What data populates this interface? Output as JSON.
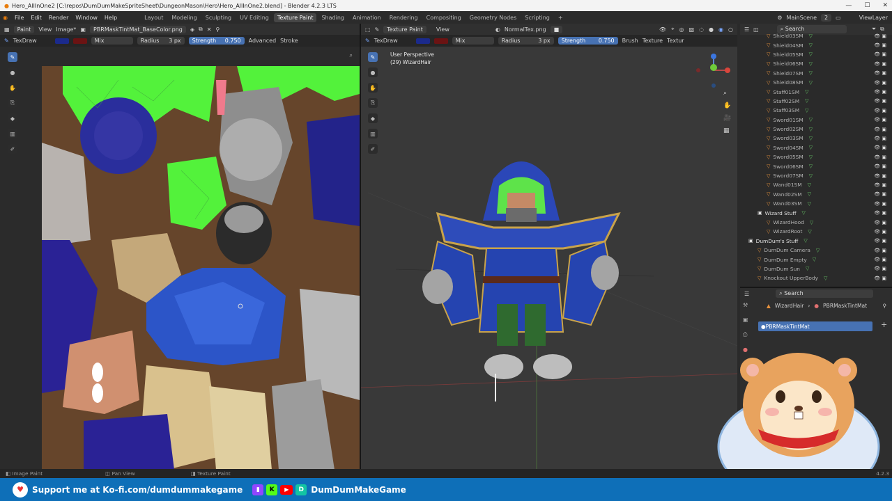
{
  "window": {
    "title": "Hero_AllInOne2 [C:\\repos\\DumDumMakeSpriteSheet\\DungeonMason\\Hero\\Hero_AllInOne2.blend] - Blender 4.2.3 LTS",
    "min": "—",
    "max": "☐",
    "close": "✕"
  },
  "menu": [
    "File",
    "Edit",
    "Render",
    "Window",
    "Help"
  ],
  "workspaces": [
    "Layout",
    "Modeling",
    "Sculpting",
    "UV Editing",
    "Texture Paint",
    "Shading",
    "Animation",
    "Rendering",
    "Compositing",
    "Geometry Nodes",
    "Scripting",
    "+"
  ],
  "scene": {
    "name": "MainScene",
    "counter": "2",
    "view_layer": "ViewLayer"
  },
  "image_editor": {
    "mode": "Paint",
    "view": "View",
    "image_menu": "Image*",
    "image_name": "PBRMaskTintMat_BaseColor.png",
    "tool_name": "TexDraw",
    "blend": "Mix",
    "radius_label": "Radius",
    "radius_value": "3 px",
    "strength_label": "Strength",
    "strength_value": "0.750",
    "advanced": "Advanced",
    "stroke": "Stroke"
  },
  "viewport": {
    "mode": "Texture Paint",
    "view": "View",
    "texture": "NormalTex.png",
    "tool_name": "TexDraw",
    "blend": "Mix",
    "radius_label": "Radius",
    "radius_value": "3 px",
    "strength_label": "Strength",
    "strength_value": "0.750",
    "brush": "Brush",
    "texture_menu": "Texture",
    "texture_more": "Textur",
    "perspective": "User Perspective",
    "object": "(29) WizardHair"
  },
  "outliner": {
    "search_placeholder": "Search",
    "items": [
      {
        "label": "Shield03SM",
        "indent": 2
      },
      {
        "label": "Shield04SM",
        "indent": 2
      },
      {
        "label": "Shield05SM",
        "indent": 2
      },
      {
        "label": "Shield06SM",
        "indent": 2
      },
      {
        "label": "Shield07SM",
        "indent": 2
      },
      {
        "label": "Shield08SM",
        "indent": 2
      },
      {
        "label": "Staff01SM",
        "indent": 2
      },
      {
        "label": "Staff02SM",
        "indent": 2
      },
      {
        "label": "Staff03SM",
        "indent": 2
      },
      {
        "label": "Sword01SM",
        "indent": 2
      },
      {
        "label": "Sword02SM",
        "indent": 2
      },
      {
        "label": "Sword03SM",
        "indent": 2
      },
      {
        "label": "Sword04SM",
        "indent": 2
      },
      {
        "label": "Sword05SM",
        "indent": 2
      },
      {
        "label": "Sword06SM",
        "indent": 2
      },
      {
        "label": "Sword07SM",
        "indent": 2
      },
      {
        "label": "Wand01SM",
        "indent": 2
      },
      {
        "label": "Wand02SM",
        "indent": 2
      },
      {
        "label": "Wand03SM",
        "indent": 2
      },
      {
        "label": "Wizard Stuff",
        "indent": 1,
        "collection": true
      },
      {
        "label": "WizardHood",
        "indent": 2
      },
      {
        "label": "WizardRoot",
        "indent": 2
      },
      {
        "label": "DumDum's Stuff",
        "indent": 0,
        "collection": true
      },
      {
        "label": "DumDum Camera",
        "indent": 1
      },
      {
        "label": "DumDum Empty",
        "indent": 1
      },
      {
        "label": "DumDum Sun",
        "indent": 1
      },
      {
        "label": "Knockout UpperBody",
        "indent": 1
      }
    ]
  },
  "properties": {
    "search_placeholder": "Search",
    "breadcrumb_object": "WizardHair",
    "breadcrumb_material": "PBRMaskTintMat",
    "slot": "PBRMaskTintMat",
    "add": "+"
  },
  "status": {
    "left": "Image Paint",
    "middle": "Pan View",
    "right": "Texture Paint",
    "version": "4.2.3"
  },
  "banner": {
    "kofi": "Support me at Ko-fi.com/dumdummakegame",
    "channel": "DumDumMakeGame"
  },
  "colors": {
    "accent": "#4772b3",
    "banner": "#0e6fb8",
    "swatch_primary": "#1b2a8c",
    "swatch_secondary": "#6b1313"
  }
}
